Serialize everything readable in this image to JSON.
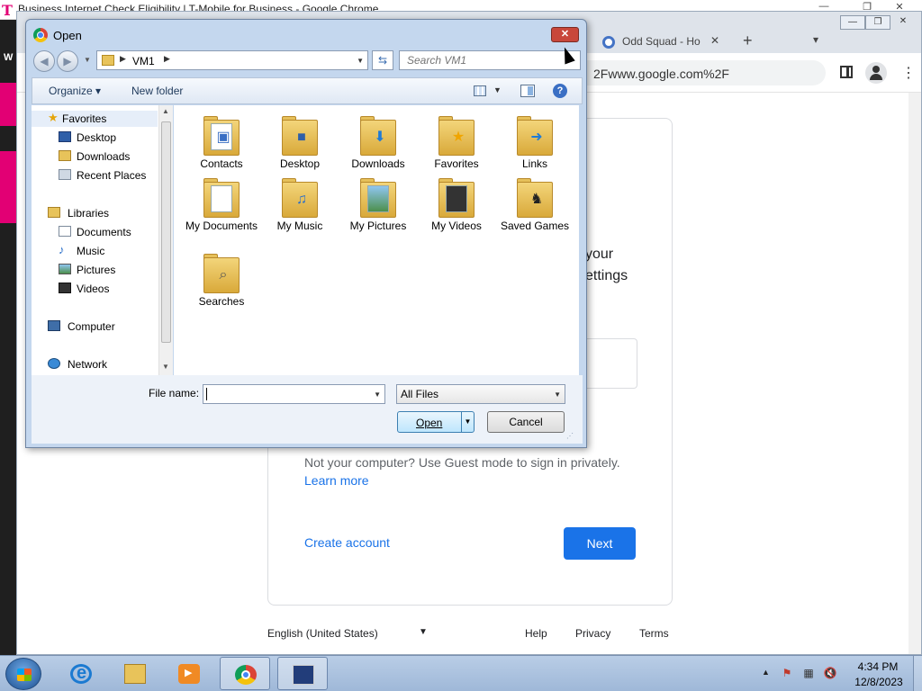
{
  "back_window": {
    "title": "Business Internet Check Eligibility | T-Mobile for Business - Google Chrome",
    "logo_letter": "T",
    "side_letter": "W"
  },
  "front_window": {
    "tab": {
      "label": "Odd Squad - Ho",
      "close": "✕"
    },
    "new_tab": "+",
    "tab_menu": "⌄",
    "url_fragment": "2Fwww.google.com%2F",
    "page": {
      "fragment_line1": "your",
      "fragment_line2": "ettings",
      "not_your_computer": "Not your computer? Use Guest mode to sign in privately.",
      "learn_more": "Learn more",
      "create_account": "Create account",
      "next": "Next"
    },
    "footer": {
      "language": "English (United States)",
      "help": "Help",
      "privacy": "Privacy",
      "terms": "Terms"
    }
  },
  "dialog": {
    "title": "Open",
    "close_glyph": "✕",
    "breadcrumb": "VM1",
    "search_placeholder": "Search VM1",
    "toolbar": {
      "organize": "Organize ▾",
      "new_folder": "New folder",
      "help": "?"
    },
    "nav": {
      "favorites": "Favorites",
      "desktop": "Desktop",
      "downloads": "Downloads",
      "recent_places": "Recent Places",
      "libraries": "Libraries",
      "documents": "Documents",
      "music": "Music",
      "pictures": "Pictures",
      "videos": "Videos",
      "computer": "Computer",
      "network": "Network"
    },
    "files": [
      {
        "label": "Contacts",
        "icon": "contact-card"
      },
      {
        "label": "Desktop",
        "icon": "monitor"
      },
      {
        "label": "Downloads",
        "icon": "down-arrow"
      },
      {
        "label": "Favorites",
        "icon": "star"
      },
      {
        "label": "Links",
        "icon": "arrow"
      },
      {
        "label": "My Documents",
        "icon": "document"
      },
      {
        "label": "My Music",
        "icon": "music-note"
      },
      {
        "label": "My Pictures",
        "icon": "picture"
      },
      {
        "label": "My Videos",
        "icon": "film"
      },
      {
        "label": "Saved Games",
        "icon": "chess-piece"
      },
      {
        "label": "Searches",
        "icon": "magnifier"
      }
    ],
    "file_name_label": "File name:",
    "file_name_value": "",
    "file_type": "All Files",
    "open_button": "Open",
    "cancel_button": "Cancel"
  },
  "taskbar": {
    "time": "4:34 PM",
    "date": "12/8/2023"
  },
  "colors": {
    "dialog_frame": "#c4d7ee",
    "close_red": "#c8473b",
    "google_blue": "#1a73e8",
    "tmobile_magenta": "#e20074"
  }
}
